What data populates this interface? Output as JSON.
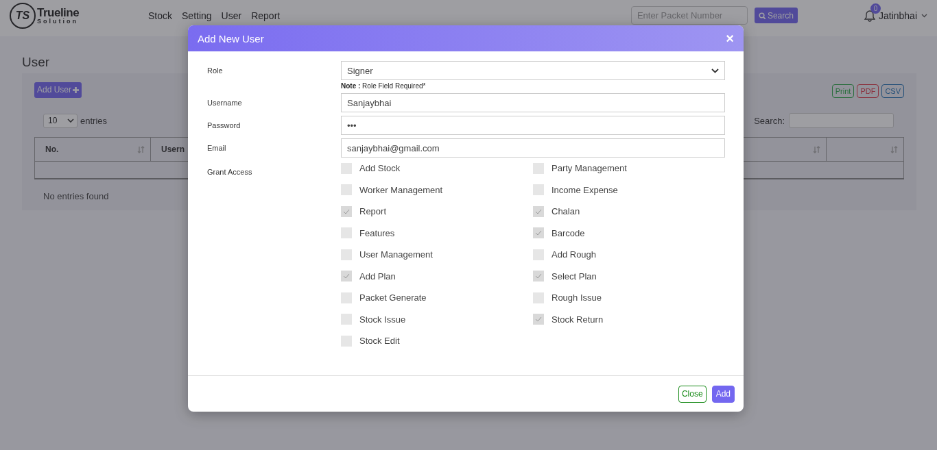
{
  "header": {
    "logo": {
      "mark": "TS",
      "title": "Trueline",
      "subtitle": "Solution"
    },
    "nav": [
      {
        "label": "Stock"
      },
      {
        "label": "Setting"
      },
      {
        "label": "User"
      },
      {
        "label": "Report"
      }
    ],
    "packet_search": {
      "placeholder": "Enter Packet Number",
      "button": "Search"
    },
    "notifications": {
      "count": "0"
    },
    "user": {
      "name": "Jatinbhai"
    }
  },
  "page": {
    "title": "User",
    "add_button": "Add User",
    "entries": {
      "value": "10",
      "label": "entries"
    },
    "export_buttons": [
      {
        "label": "Print",
        "kind": "success"
      },
      {
        "label": "PDF",
        "kind": "danger"
      },
      {
        "label": "CSV",
        "kind": "info"
      }
    ],
    "search_label": "Search:",
    "table": {
      "columns": [
        {
          "label": "No."
        },
        {
          "label": "Usern"
        }
      ],
      "empty_message": "No entries found"
    }
  },
  "modal": {
    "title": "Add New User",
    "close": "×",
    "fields": [
      {
        "label": "Role",
        "kind": "select",
        "value": "Signer",
        "note": "**Note :** Role Field Required*"
      },
      {
        "label": "Username",
        "kind": "text",
        "value": "Sanjaybhai"
      },
      {
        "label": "Password",
        "kind": "password",
        "value": "•••"
      },
      {
        "label": "Email",
        "kind": "text",
        "value": "sanjaybhai@gmail.com"
      }
    ],
    "grant_access": {
      "label": "Grant Access",
      "permissions": [
        {
          "label": "Add Stock",
          "checked": false
        },
        {
          "label": "Party Management",
          "checked": false
        },
        {
          "label": "Worker Management",
          "checked": false
        },
        {
          "label": "Income Expense",
          "checked": false
        },
        {
          "label": "Report",
          "checked": true
        },
        {
          "label": "Chalan",
          "checked": true
        },
        {
          "label": "Features",
          "checked": false
        },
        {
          "label": "Barcode",
          "checked": true
        },
        {
          "label": "User Management",
          "checked": false
        },
        {
          "label": "Add Rough",
          "checked": false
        },
        {
          "label": "Add Plan",
          "checked": true
        },
        {
          "label": "Select Plan",
          "checked": true
        },
        {
          "label": "Packet Generate",
          "checked": false
        },
        {
          "label": "Rough Issue",
          "checked": false
        },
        {
          "label": "Stock Issue",
          "checked": false
        },
        {
          "label": "Stock Return",
          "checked": true
        },
        {
          "label": "Stock Edit",
          "checked": false
        }
      ]
    },
    "buttons": [
      {
        "label": "Close",
        "kind": "outline"
      },
      {
        "label": "Add",
        "kind": "primary"
      }
    ]
  }
}
